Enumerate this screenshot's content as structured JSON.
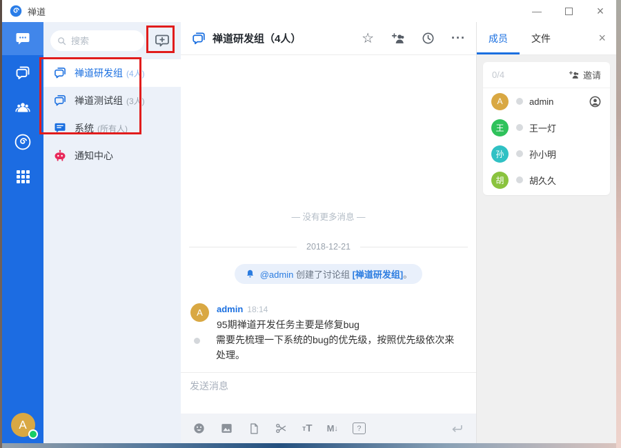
{
  "titlebar": {
    "app_title": "禅道",
    "minimize_glyph": "—",
    "close_glyph": "×"
  },
  "sidebar": {
    "user_initial": "A"
  },
  "chat_list": {
    "search_placeholder": "搜索",
    "items": [
      {
        "label": "禅道研发组",
        "meta": "(4人)"
      },
      {
        "label": "禅道测试组",
        "meta": "(3人)"
      },
      {
        "label": "系统",
        "meta": "(所有人)"
      },
      {
        "label": "通知中心",
        "meta": ""
      }
    ]
  },
  "chat": {
    "title": "禅道研发组（4人）",
    "star_glyph": "☆",
    "more_glyph": "···",
    "no_more": "— 没有更多消息 —",
    "date": "2018-12-21",
    "notice_mention": "@admin",
    "notice_text": "创建了讨论组",
    "notice_group": "[禅道研发组]",
    "notice_end": "。",
    "msg1_author": "admin",
    "msg1_author_initial": "A",
    "msg1_time": "18:14",
    "msg1_text": "95期禅道开发任务主要是修复bug",
    "msg2_text": "需要先梳理一下系统的bug的优先级，按照优先级依次来处理。"
  },
  "composer": {
    "placeholder": "发送消息",
    "format_t_small": "т",
    "format_t_big": "T",
    "markdown_m": "M",
    "markdown_arrow": "↓",
    "help_glyph": "?"
  },
  "members": {
    "tab_members": "成员",
    "tab_files": "文件",
    "close_glyph": "×",
    "count": "0/4",
    "invite": "邀请",
    "list": [
      {
        "initial": "A",
        "name": "admin",
        "color": "#d9a843"
      },
      {
        "initial": "王",
        "name": "王一灯",
        "color": "#2fc25b"
      },
      {
        "initial": "孙",
        "name": "孙小明",
        "color": "#30c1c4"
      },
      {
        "initial": "胡",
        "name": "胡久久",
        "color": "#8ac33e"
      }
    ]
  },
  "colors": {
    "accent": "#1a6fe0",
    "sidebar": "#1c6ce2",
    "annotation": "#e11c1c",
    "notify_red": "#e8285a",
    "online_green": "#17ce66"
  }
}
